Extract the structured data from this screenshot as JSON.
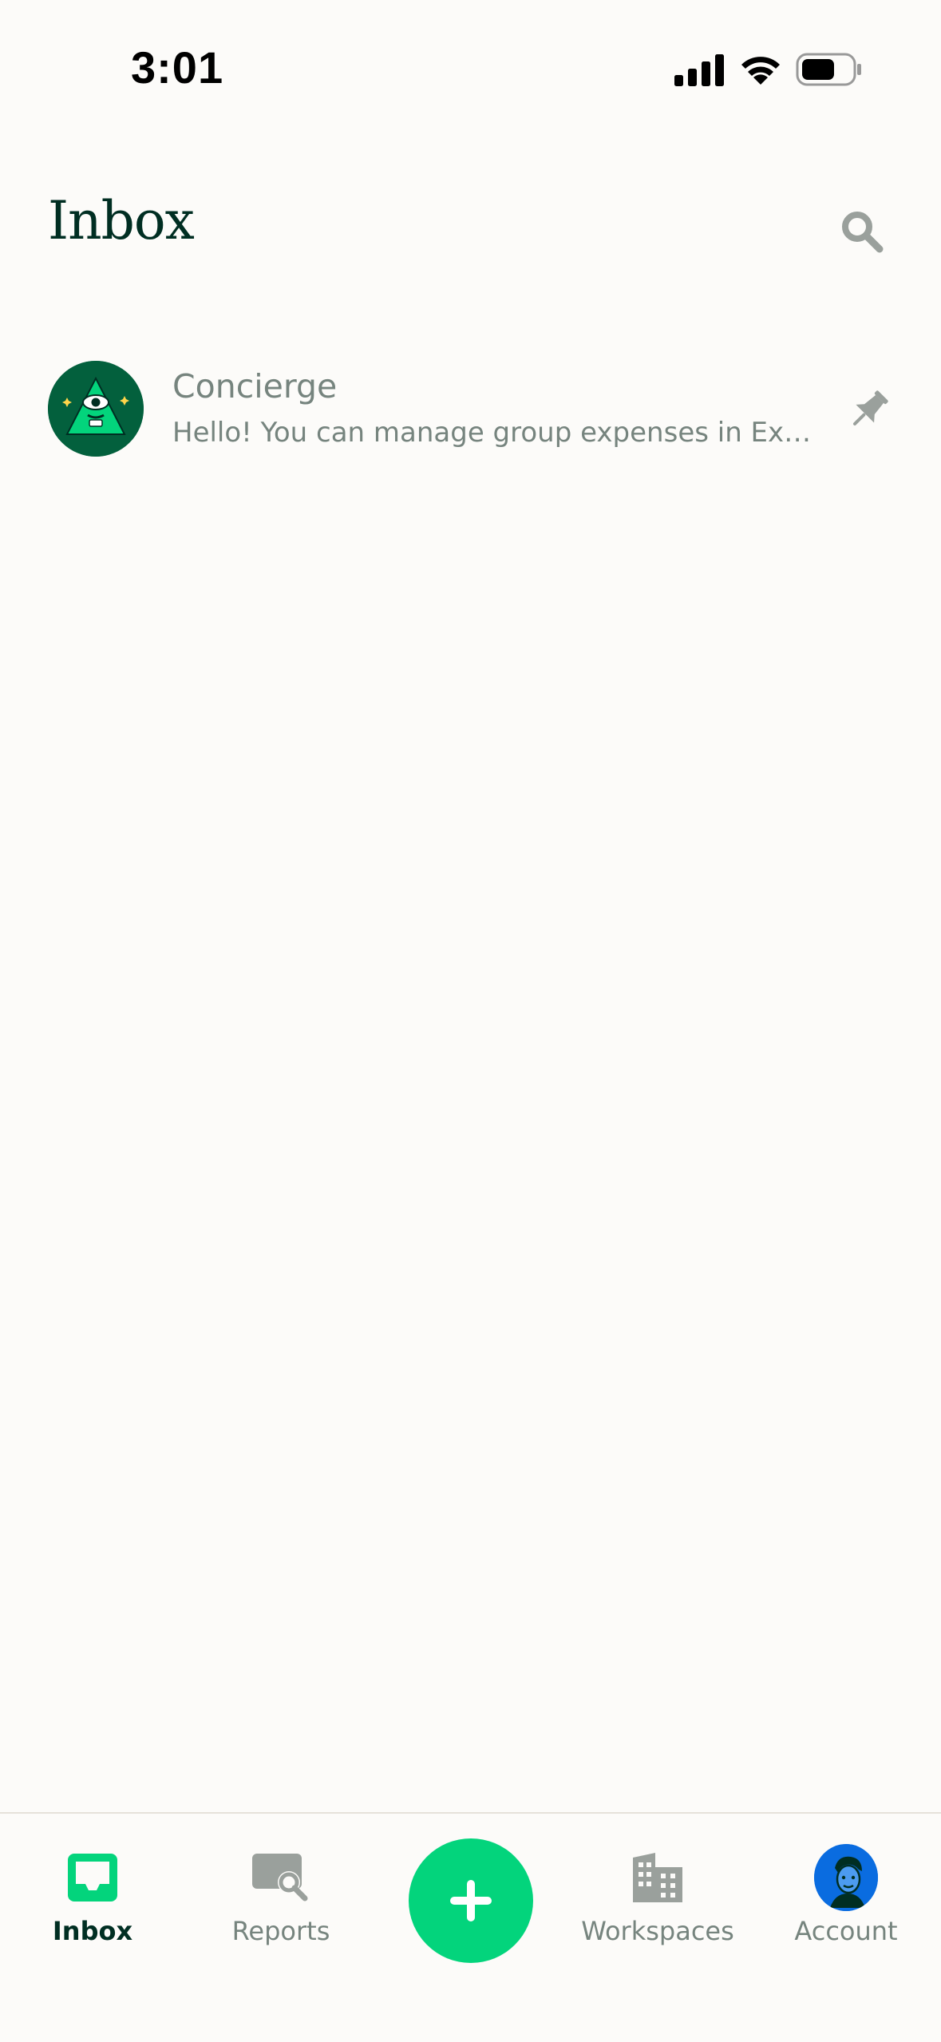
{
  "status_bar": {
    "time": "3:01"
  },
  "header": {
    "title": "Inbox",
    "search_icon": "search-icon"
  },
  "chats": [
    {
      "name": "Concierge",
      "preview": "Hello! You can manage group expenses in Expensify",
      "pinned": true,
      "avatar_icon": "concierge-avatar"
    }
  ],
  "tab_bar": {
    "tabs": [
      {
        "label": "Inbox",
        "icon": "inbox-icon",
        "active": true
      },
      {
        "label": "Reports",
        "icon": "reports-icon",
        "active": false
      },
      {
        "label": "Workspaces",
        "icon": "workspaces-icon",
        "active": false
      },
      {
        "label": "Account",
        "icon": "account-avatar",
        "active": false
      }
    ],
    "fab_icon": "plus-icon"
  },
  "colors": {
    "background": "#FCFBF9",
    "title": "#002E22",
    "muted_text": "#76847E",
    "accent_green": "#03D47C",
    "avatar_green": "#03603D",
    "icon_gray": "#9AA09C"
  }
}
